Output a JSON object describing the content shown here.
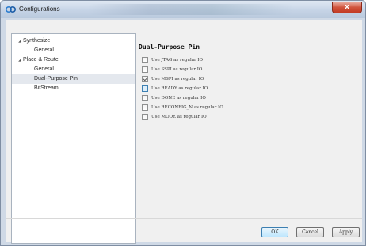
{
  "window": {
    "title": "Configurations",
    "close_label": "x"
  },
  "icons": {
    "app": "app-icon",
    "close": "close-icon",
    "expand": "expand-arrow-icon"
  },
  "sidebar": {
    "items": [
      {
        "label": "Synthesize",
        "expandable": true,
        "indent": 0,
        "selected": false
      },
      {
        "label": "General",
        "expandable": false,
        "indent": 1,
        "selected": false
      },
      {
        "label": "Place & Route",
        "expandable": true,
        "indent": 0,
        "selected": false
      },
      {
        "label": "General",
        "expandable": false,
        "indent": 1,
        "selected": false
      },
      {
        "label": "Dual-Purpose Pin",
        "expandable": false,
        "indent": 1,
        "selected": true
      },
      {
        "label": "BitStream",
        "expandable": false,
        "indent": 1,
        "selected": false
      }
    ],
    "expand_glyph": "◢"
  },
  "main": {
    "title": "Dual-Purpose Pin",
    "options": [
      {
        "label": "Use JTAG as regular IO",
        "checked": false
      },
      {
        "label": "Use SSPI as regular IO",
        "checked": false
      },
      {
        "label": "Use MSPI as regular IO",
        "checked": true
      },
      {
        "label": "Use READY as regular IO",
        "checked": false,
        "focused": true
      },
      {
        "label": "Use DONE as regular IO",
        "checked": false
      },
      {
        "label": "Use RECONFIG_N as regular IO",
        "checked": false
      },
      {
        "label": "Use MODE as regular IO",
        "checked": false
      }
    ]
  },
  "footer": {
    "ok_label": "OK",
    "cancel_label": "Cancel",
    "apply_label": "Apply"
  },
  "colors": {
    "accent": "#3c7fb1",
    "close_red": "#c23b24",
    "selection": "#e4e8ee"
  }
}
